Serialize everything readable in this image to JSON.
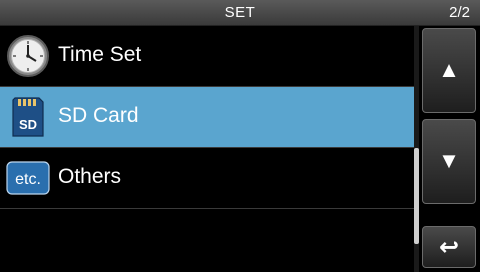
{
  "header": {
    "title": "SET",
    "page_indicator": "2/2"
  },
  "menu": {
    "items": [
      {
        "label": "Time Set",
        "icon": "clock-icon",
        "selected": false
      },
      {
        "label": "SD Card",
        "icon": "sd-card-icon",
        "icon_text": "SD",
        "selected": true
      },
      {
        "label": "Others",
        "icon": "etc-icon",
        "icon_text": "etc.",
        "selected": false
      }
    ]
  },
  "buttons": {
    "up_glyph": "▲",
    "down_glyph": "▼",
    "back_glyph": "↩"
  },
  "colors": {
    "selected_row": "#5aa5cf",
    "background": "#000000"
  }
}
